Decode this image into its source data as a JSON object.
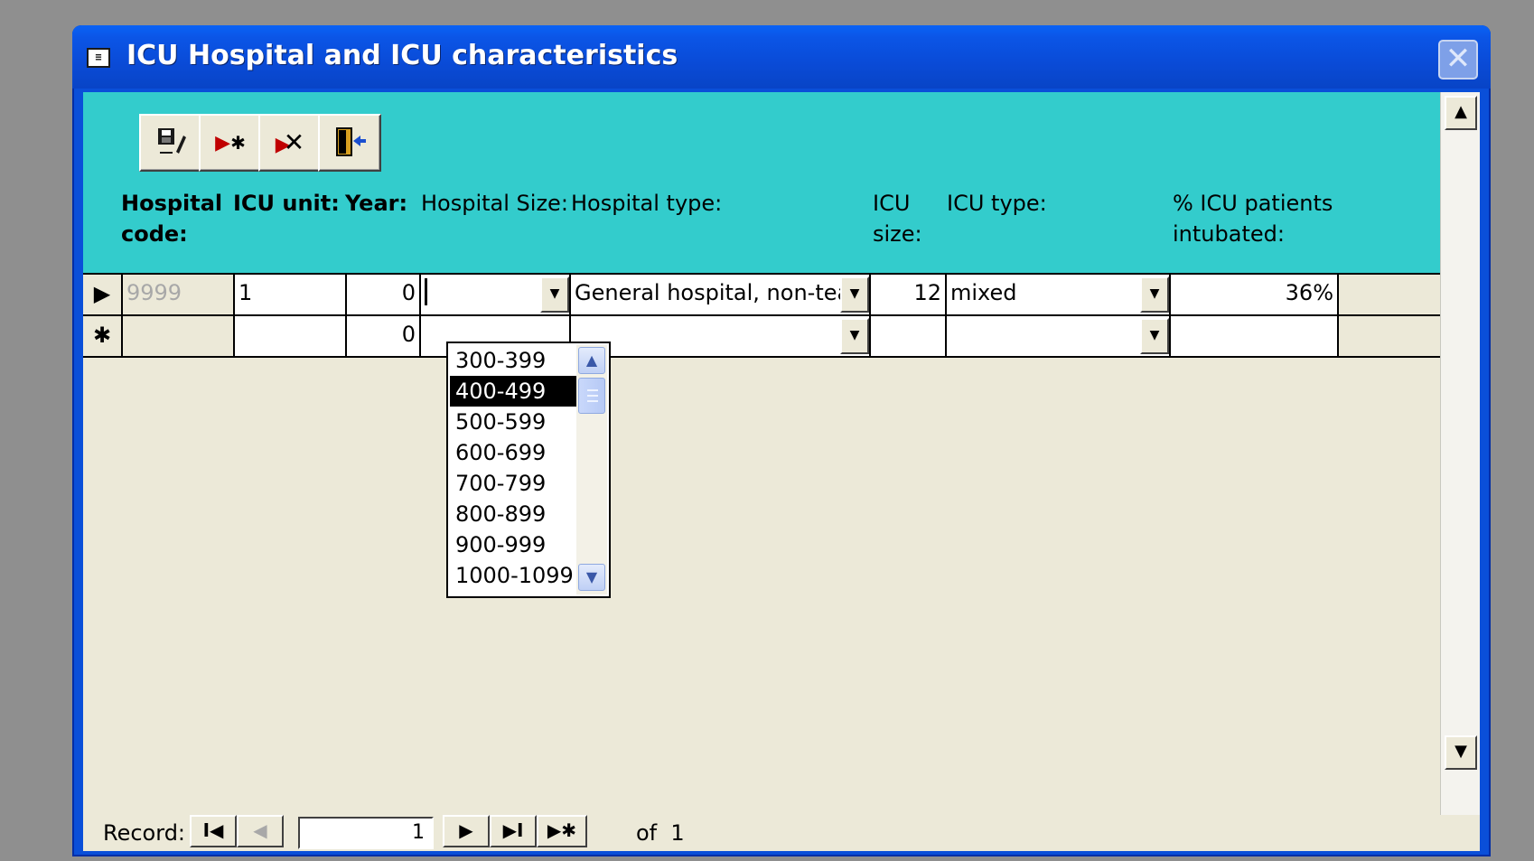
{
  "window": {
    "title": "ICU Hospital and ICU characteristics",
    "close_label": "✕"
  },
  "toolbar": {
    "buttons": [
      {
        "name": "save-record",
        "glyph": "💾"
      },
      {
        "name": "new-record",
        "glyph": "▸✱"
      },
      {
        "name": "delete-record",
        "glyph": "✗"
      },
      {
        "name": "exit-form",
        "glyph": "⇦"
      }
    ]
  },
  "columns": {
    "hospital_code": "Hospital\ncode:",
    "icu_unit": "ICU unit:",
    "year": "Year:",
    "hospital_size": "Hospital Size:",
    "hospital_type": "Hospital type:",
    "icu_size": "ICU\nsize:",
    "icu_type": "ICU type:",
    "pct_intubated": "% ICU patients\nintubated:"
  },
  "rows": [
    {
      "selector": "▶",
      "hospital_code": "9999",
      "icu_unit": "1",
      "year": "0",
      "hospital_size": "",
      "hospital_type": "General hospital, non-teach",
      "icu_size": "12",
      "icu_type": "mixed",
      "pct_intubated": "36%"
    },
    {
      "selector": "✱",
      "hospital_code": "",
      "icu_unit": "",
      "year": "0",
      "hospital_size": "",
      "hospital_type": "",
      "icu_size": "",
      "icu_type": "",
      "pct_intubated": ""
    }
  ],
  "hospital_size_options": {
    "visible": [
      "300-399",
      "400-499",
      "500-599",
      "600-699",
      "700-799",
      "800-899",
      "900-999",
      "1000-1099"
    ],
    "highlighted": "400-499"
  },
  "navigation": {
    "label": "Record:",
    "current": "1",
    "of_label": "of",
    "total": "1",
    "first_glyph": "I◀",
    "prev_glyph": "◀",
    "next_glyph": "▶",
    "last_glyph": "▶I",
    "new_glyph": "▶✱"
  }
}
